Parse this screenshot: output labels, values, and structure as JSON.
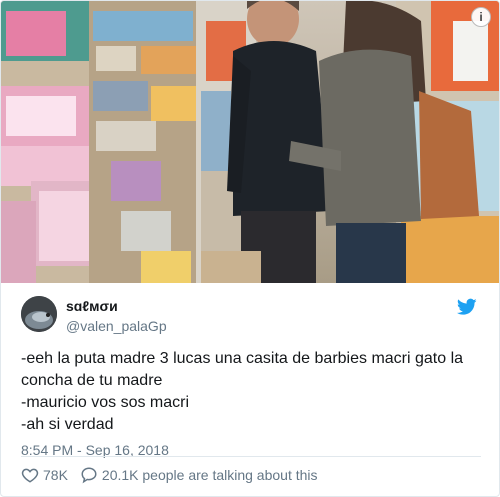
{
  "tweet": {
    "display_name": "sɑℓмσи",
    "handle": "@valen_palaGp",
    "text": "-eeh la puta madre 3 lucas una casita de barbies macri gato la concha de tu madre\n-mauricio vos sos macri\n-ah si verdad",
    "timestamp": "8:54 PM - Sep 16, 2018"
  },
  "actions": {
    "likes": "78K",
    "talking": "20.1K people are talking about this"
  },
  "colors": {
    "twitter_blue": "#1da1f2",
    "secondary_text": "#657786"
  },
  "icons": {
    "info": "info-icon",
    "bird": "twitter-bird-icon",
    "like": "heart-icon",
    "reply": "speech-bubble-icon"
  }
}
